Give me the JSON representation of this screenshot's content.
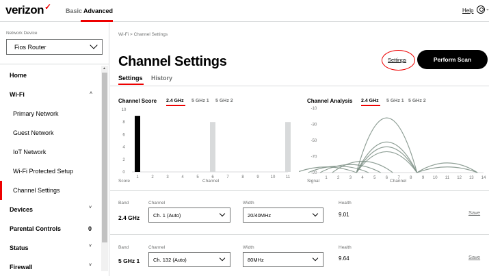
{
  "header": {
    "logo": "verizon",
    "logo_mark": "✓",
    "nav_basic": "Basic",
    "nav_advanced": "Advanced",
    "help": "Help",
    "user_caret": "⌄",
    "accent_color": "#ee0000"
  },
  "sidebar": {
    "network_device_label": "Network Device",
    "device_value": "Fios Router",
    "scroll_up": "▲",
    "items": [
      {
        "label": "Home",
        "type": "top"
      },
      {
        "label": "Wi-Fi",
        "type": "top",
        "arrow": "˄"
      },
      {
        "label": "Primary Network",
        "type": "sub"
      },
      {
        "label": "Guest Network",
        "type": "sub"
      },
      {
        "label": "IoT Network",
        "type": "sub"
      },
      {
        "label": "Wi-Fi Protected Setup",
        "type": "sub"
      },
      {
        "label": "Channel Settings",
        "type": "sub",
        "active": true
      },
      {
        "label": "Devices",
        "type": "top",
        "arrow": "˅"
      },
      {
        "label": "Parental Controls",
        "type": "top",
        "badge": "0"
      },
      {
        "label": "Status",
        "type": "top",
        "arrow": "˅"
      },
      {
        "label": "Firewall",
        "type": "top",
        "arrow": "˅"
      }
    ]
  },
  "main": {
    "breadcrumb": "Wi-Fi  >  Channel Settings",
    "title": "Channel Settings",
    "settings_link": "Settings",
    "scan_button": "Perform Scan",
    "tabs": [
      "Settings",
      "History"
    ],
    "score_title": "Channel Score",
    "analysis_title": "Channel Analysis",
    "bands": [
      "2.4 GHz",
      "5 GHz 1",
      "5 GHz 2"
    ],
    "score_foot_left": "Score",
    "score_foot_center": "Channel",
    "analysis_foot_left": "Signal",
    "analysis_foot_center": "Channel",
    "rows": [
      {
        "band_label": "Band",
        "band_value": "2.4 GHz",
        "channel_label": "Channel",
        "channel_value": "Ch. 1 (Auto)",
        "width_label": "Width",
        "width_value": "20/40MHz",
        "health_label": "Health",
        "health_value": "9.01",
        "save": "Save"
      },
      {
        "band_label": "Band",
        "band_value": "5 GHz 1",
        "channel_label": "Channel",
        "channel_value": "Ch. 132 (Auto)",
        "width_label": "Width",
        "width_value": "80MHz",
        "health_label": "Health",
        "health_value": "9.64",
        "save": "Save"
      }
    ]
  },
  "chart_data": [
    {
      "type": "bar",
      "title": "Channel Score",
      "xlabel": "Channel",
      "ylabel": "Score",
      "categories": [
        "1",
        "2",
        "3",
        "4",
        "5",
        "6",
        "7",
        "8",
        "9",
        "10",
        "11"
      ],
      "values": [
        9,
        0,
        0,
        0,
        0,
        8,
        0,
        0,
        0,
        0,
        8
      ],
      "highlight": "1",
      "ylim": [
        0,
        10
      ],
      "yticks": [
        0,
        2,
        4,
        6,
        8,
        10
      ],
      "colors": {
        "selected": "#000000",
        "other": "#d8dadb"
      }
    },
    {
      "type": "line",
      "title": "Channel Analysis",
      "xlabel": "Channel",
      "ylabel": "Signal",
      "x": [
        1,
        2,
        3,
        4,
        5,
        6,
        7,
        8,
        9,
        10,
        11,
        12,
        13,
        14
      ],
      "ylim": [
        -90,
        -10
      ],
      "yticks": [
        -10,
        -30,
        -50,
        -70,
        -90
      ],
      "color": "#7b8e84",
      "series": [
        {
          "center": 6,
          "span": 2.5,
          "peak": -22
        },
        {
          "center": 6,
          "span": 2.5,
          "peak": -52
        },
        {
          "center": 6,
          "span": 2.5,
          "peak": -58
        },
        {
          "center": 6,
          "span": 2.5,
          "peak": -64
        },
        {
          "center": 4,
          "span": 2.5,
          "peak": -76
        },
        {
          "center": 3,
          "span": 2.5,
          "peak": -80
        },
        {
          "center": 2,
          "span": 2.5,
          "peak": -82
        },
        {
          "center": 1,
          "span": 2.5,
          "peak": -83
        },
        {
          "center": 11,
          "span": 2.5,
          "peak": -78
        },
        {
          "center": 11,
          "span": 2.5,
          "peak": -83
        }
      ]
    }
  ]
}
